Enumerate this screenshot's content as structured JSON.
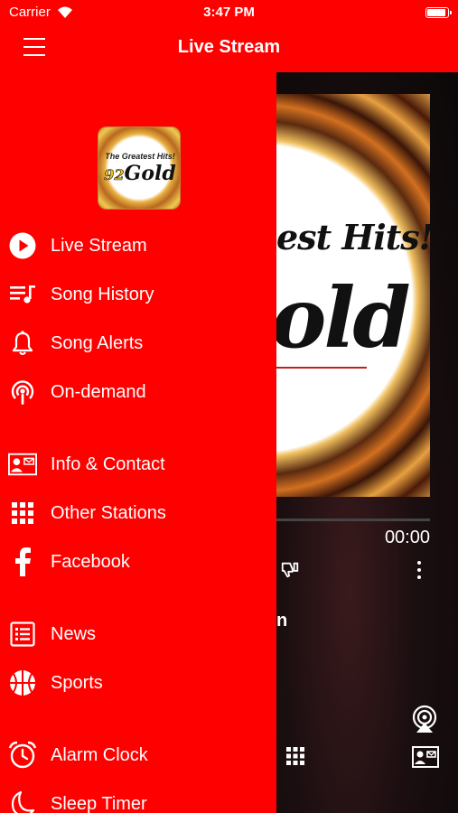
{
  "status_bar": {
    "carrier": "Carrier",
    "time": "3:47 PM"
  },
  "navbar": {
    "title": "Live Stream"
  },
  "drawer": {
    "logo": {
      "tagline": "The Greatest Hits!",
      "number": "92",
      "name": "Gold"
    },
    "items": [
      {
        "label": "Live Stream",
        "icon": "play-circle-icon"
      },
      {
        "label": "Song History",
        "icon": "playlist-icon"
      },
      {
        "label": "Song Alerts",
        "icon": "bell-icon"
      },
      {
        "label": "On-demand",
        "icon": "podcast-icon"
      },
      {
        "label": "Info & Contact",
        "icon": "contact-card-icon"
      },
      {
        "label": "Other Stations",
        "icon": "grid-icon"
      },
      {
        "label": "Facebook",
        "icon": "facebook-icon"
      },
      {
        "label": "News",
        "icon": "news-icon"
      },
      {
        "label": "Sports",
        "icon": "basketball-icon"
      },
      {
        "label": "Alarm Clock",
        "icon": "alarm-clock-icon"
      },
      {
        "label": "Sleep Timer",
        "icon": "moon-icon"
      }
    ]
  },
  "player": {
    "artwork_text_line1": "est Hits!",
    "artwork_text_line2": "old",
    "elapsed": "00:00",
    "song_fragment": "n"
  },
  "colors": {
    "brand_red": "#ff0000",
    "text": "#ffffff"
  }
}
